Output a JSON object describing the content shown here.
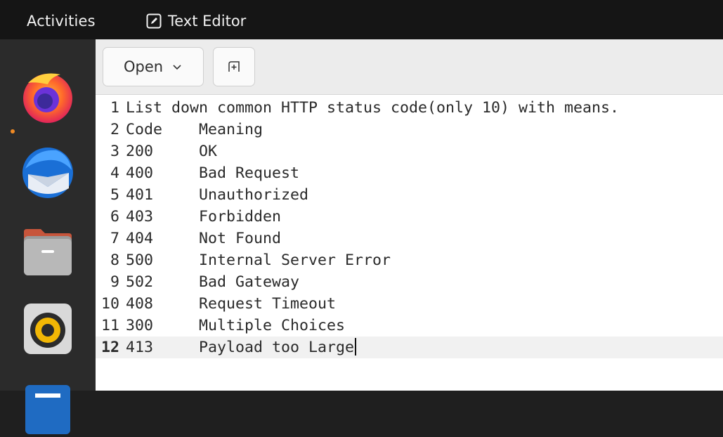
{
  "topbar": {
    "activities": "Activities",
    "app_name": "Text Editor"
  },
  "dock": {
    "items": [
      {
        "name": "firefox-icon",
        "running": true
      },
      {
        "name": "thunderbird-icon",
        "running": false
      },
      {
        "name": "files-icon",
        "running": false
      },
      {
        "name": "rhythmbox-icon",
        "running": false
      }
    ]
  },
  "toolbar": {
    "open_label": "Open",
    "new_tab_icon": "new-tab-icon"
  },
  "editor": {
    "current_line": 12,
    "lines": [
      {
        "num": "1",
        "text": "List down common HTTP status code(only 10) with means."
      },
      {
        "num": "2",
        "text": "Code    Meaning"
      },
      {
        "num": "3",
        "text": "200     OK"
      },
      {
        "num": "4",
        "text": "400     Bad Request"
      },
      {
        "num": "5",
        "text": "401     Unauthorized"
      },
      {
        "num": "6",
        "text": "403     Forbidden"
      },
      {
        "num": "7",
        "text": "404     Not Found"
      },
      {
        "num": "8",
        "text": "500     Internal Server Error"
      },
      {
        "num": "9",
        "text": "502     Bad Gateway"
      },
      {
        "num": "10",
        "text": "408     Request Timeout"
      },
      {
        "num": "11",
        "text": "300     Multiple Choices"
      },
      {
        "num": "12",
        "text": "413     Payload too Large"
      }
    ]
  }
}
